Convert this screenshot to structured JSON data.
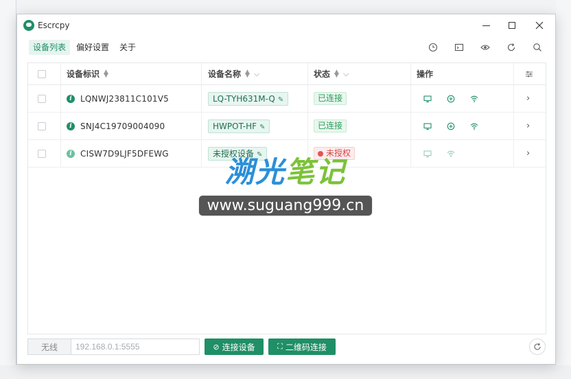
{
  "window": {
    "title": "Escrcpy"
  },
  "nav": {
    "items": [
      "设备列表",
      "偏好设置",
      "关于"
    ]
  },
  "table": {
    "headers": {
      "id": "设备标识",
      "name": "设备名称",
      "status": "状态",
      "actions": "操作"
    },
    "rows": [
      {
        "id": "LQNWJ23811C101V5",
        "name": "LQ-TYH631M-Q",
        "status": "已连接"
      },
      {
        "id": "SNJ4C19709004090",
        "name": "HWPOT-HF",
        "status": "已连接"
      },
      {
        "id": "CISW7D9LJF5DFEWG",
        "name": "未授权设备",
        "status": "未授权"
      }
    ]
  },
  "watermark": {
    "text_blue": "溯光",
    "text_green": "笔记",
    "url": "www.suguang999.cn"
  },
  "footer": {
    "wireless_label": "无线",
    "ip_placeholder": "192.168.0.1:5555",
    "connect_label": "连接设备",
    "qr_label": "二维码连接"
  },
  "colors": {
    "accent": "#1f8f66",
    "connected": "#2c9b5a",
    "unauthorized": "#d64545"
  }
}
